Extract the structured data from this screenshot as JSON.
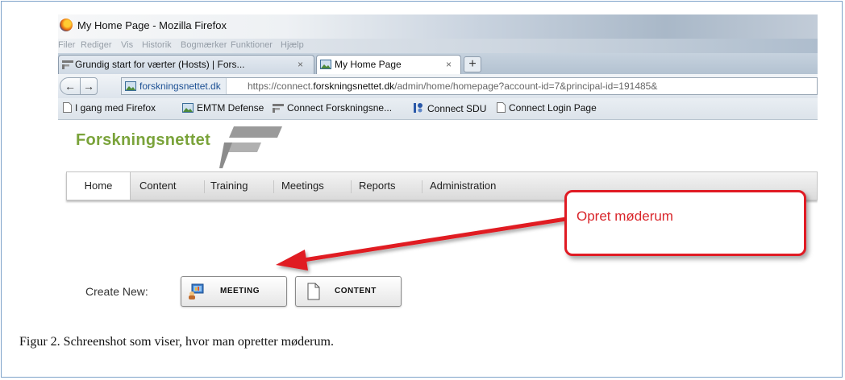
{
  "browser": {
    "window_title": "My Home Page - Mozilla Firefox",
    "menu": [
      "Filer",
      "Rediger",
      "Vis",
      "Historik",
      "Bogmærker",
      "Funktioner",
      "Hjælp"
    ],
    "tabs": [
      {
        "label": "Grundig start for værter (Hosts) | Fors...",
        "close": "×"
      },
      {
        "label": "My Home Page",
        "close": "×"
      }
    ],
    "new_tab": "+",
    "back": "←",
    "forward": "→",
    "site_identity": "forskningsnettet.dk",
    "url_prefix": "https://connect.",
    "url_domain": "forskningsnettet.dk",
    "url_rest": "/admin/home/homepage?account-id=7&principal-id=191485&",
    "bookmarks": [
      "I gang med Firefox",
      "EMTM Defense",
      "Connect Forskningsne...",
      "Connect SDU",
      "Connect Login Page"
    ]
  },
  "page": {
    "logo_text": "Forskningsnettet",
    "nav": [
      "Home",
      "Content",
      "Training",
      "Meetings",
      "Reports",
      "Administration"
    ],
    "create_new_label": "Create New:",
    "meeting_button": "MEETING",
    "content_button": "CONTENT"
  },
  "callout": {
    "text": "Opret møderum"
  },
  "caption": "Figur 2. Schreenshot som viser, hvor man opretter møderum."
}
